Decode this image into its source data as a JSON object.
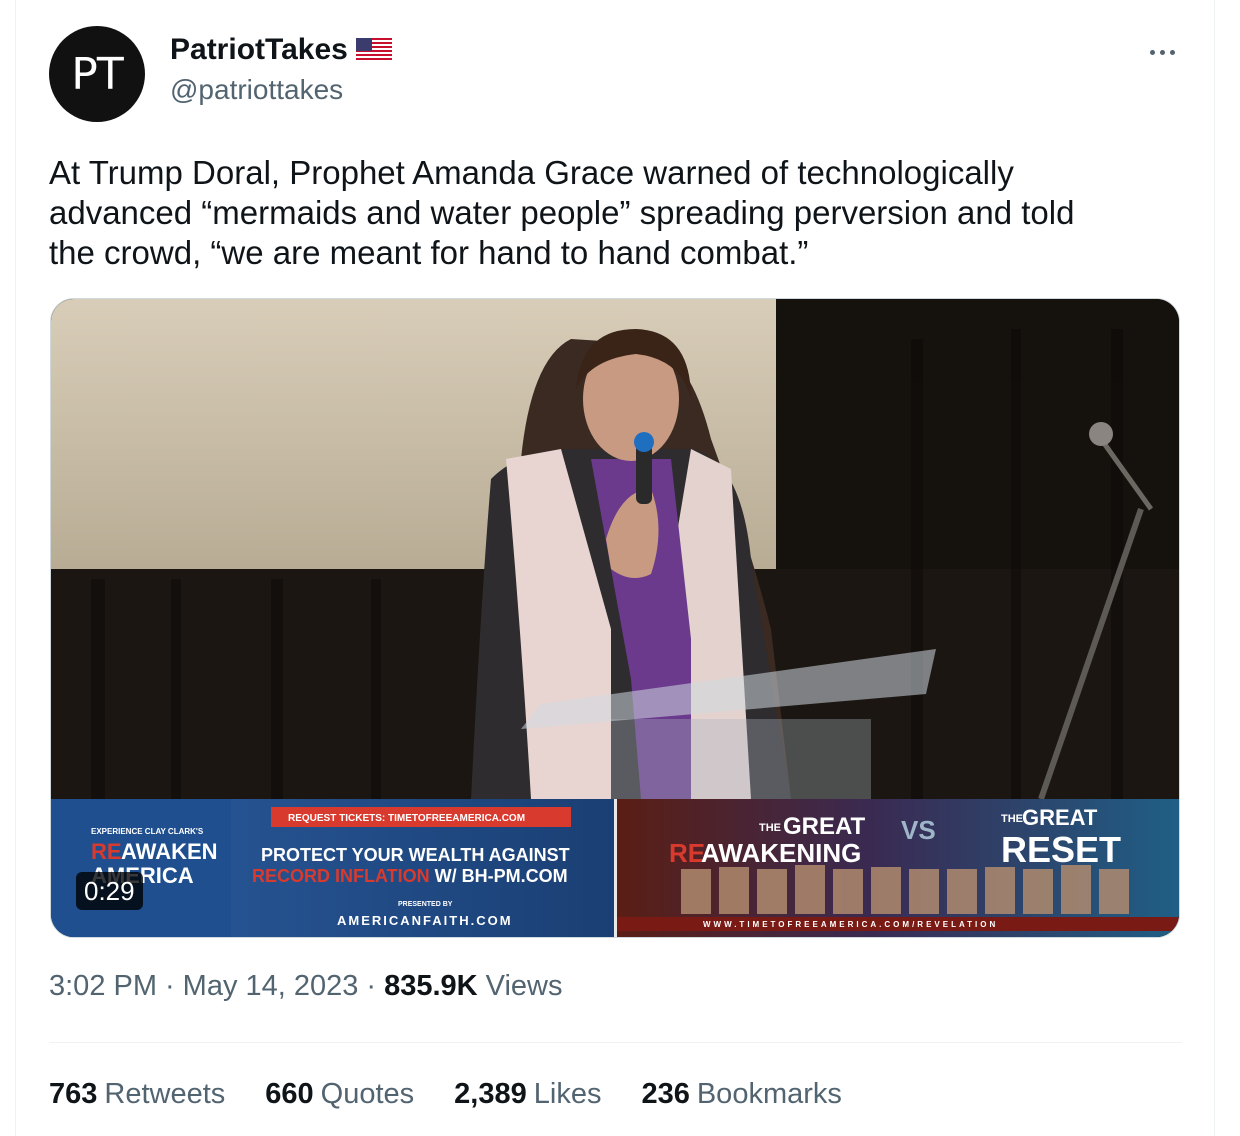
{
  "author": {
    "avatar_initials": "PT",
    "display_name": "PatriotTakes",
    "handle": "@patriottakes",
    "badge_icon": "us-flag-icon"
  },
  "menu": {
    "more_icon": "more-options-icon"
  },
  "tweet": {
    "text": "At Trump Doral, Prophet Amanda Grace warned of technologically\nadvanced “mermaids and water people” spreading perversion and told\nthe crowd, “we are meant for hand to hand combat.”"
  },
  "video": {
    "duration": "0:29",
    "banner": {
      "experience_label": "EXPERIENCE CLAY CLARK'S",
      "reawaken_line1": "AWAKEN",
      "reawaken_prefix": "RE",
      "reawaken_line2": "AMERICA",
      "request_tickets": "REQUEST TICKETS: TIMETOFREEAMERICA.COM",
      "protect_line1": "PROTECT YOUR WEALTH AGAINST",
      "protect_line2_red": "RECORD INFLATION",
      "protect_line2_white": " W/ BH-PM.COM",
      "presented_by": "PRESENTED BY",
      "americanfaith": "AMERICANFAITH.COM",
      "great_awakening_the": "THE",
      "great_awakening_great": "GREAT",
      "great_awakening_re": "RE",
      "great_awakening_awakening": "AWAKENING",
      "vs": "VS",
      "great_reset_the": "THE",
      "great_reset_great": "GREAT",
      "great_reset_reset": "RESET",
      "url_strip": "WWW.TIMETOFREEAMERICA.COM/REVELATION"
    }
  },
  "meta": {
    "time": "3:02 PM",
    "sep1": "·",
    "date": "May 14, 2023",
    "sep2": "·",
    "views_count": "835.9K",
    "views_label": "Views"
  },
  "stats": [
    {
      "count": "763",
      "label": "Retweets"
    },
    {
      "count": "660",
      "label": "Quotes"
    },
    {
      "count": "2,389",
      "label": "Likes"
    },
    {
      "count": "236",
      "label": "Bookmarks"
    }
  ],
  "colors": {
    "text_primary": "#0f1419",
    "text_secondary": "#536471",
    "banner_blue": "#1f4e8c",
    "banner_red": "#d83a2e"
  }
}
